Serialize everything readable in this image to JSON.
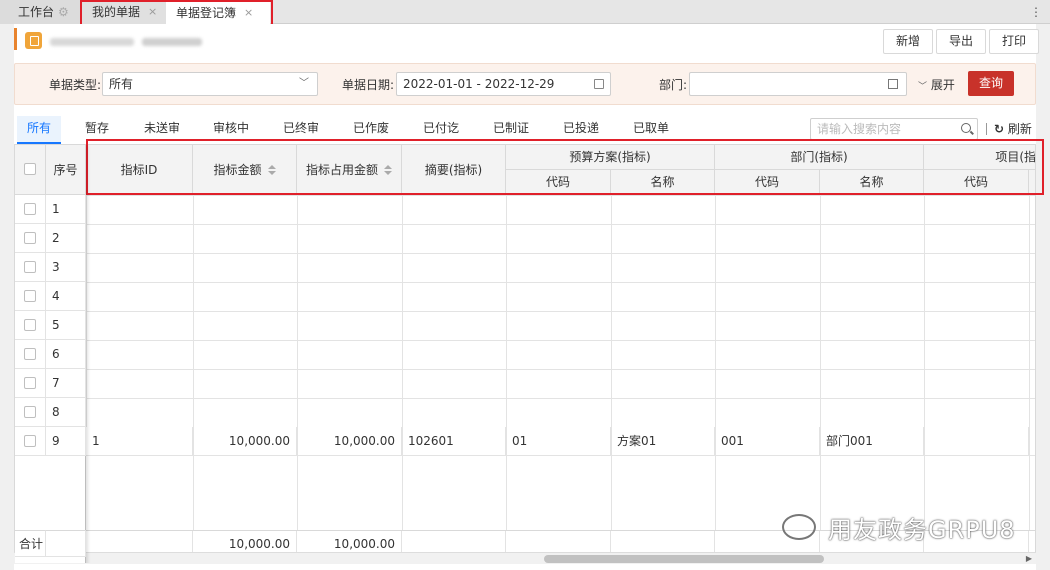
{
  "tabs": {
    "workbench": "工作台",
    "my_docs": "我的单据",
    "register": "单据登记簿",
    "close": "×"
  },
  "toolbar": {
    "new_label": "新增",
    "export_label": "导出",
    "print_label": "打印"
  },
  "filter": {
    "type_label": "单据类型:",
    "type_value": "所有",
    "date_label": "单据日期:",
    "date_value": "2022-01-01 - 2022-12-29",
    "dept_label": "部门:",
    "dept_value": "",
    "expand_label": "展开",
    "query_label": "查询"
  },
  "status_tabs": [
    "所有",
    "暂存",
    "未送审",
    "审核中",
    "已终审",
    "已作废",
    "已付讫",
    "已制证",
    "已投递",
    "已取单"
  ],
  "search": {
    "placeholder": "请输入搜索内容"
  },
  "refresh_label": "刷新",
  "grid": {
    "headers": {
      "seq": "序号",
      "indicator_id": "指标ID",
      "indicator_amount": "指标金额",
      "indicator_used": "指标占用金额",
      "summary": "摘要(指标)",
      "budget_plan": "预算方案(指标)",
      "dept": "部门(指标)",
      "project": "项目(指",
      "code": "代码",
      "name": "名称"
    },
    "row_numbers": [
      "1",
      "2",
      "3",
      "4",
      "5",
      "6",
      "7",
      "8",
      "9"
    ],
    "data_row": {
      "indicator_id": "1",
      "indicator_amount": "10,000.00",
      "indicator_used": "10,000.00",
      "summary": "102601",
      "plan_code": "01",
      "plan_name": "方案01",
      "dept_code": "001",
      "dept_name": "部门001"
    },
    "total": {
      "label": "合计",
      "indicator_amount": "10,000.00",
      "indicator_used": "10,000.00"
    }
  },
  "watermark": "用友政务GRPU8",
  "colors": {
    "accent": "#1677ff",
    "query": "#c8322a",
    "highlight": "#e0202a",
    "title_icon": "#f0a53a"
  }
}
